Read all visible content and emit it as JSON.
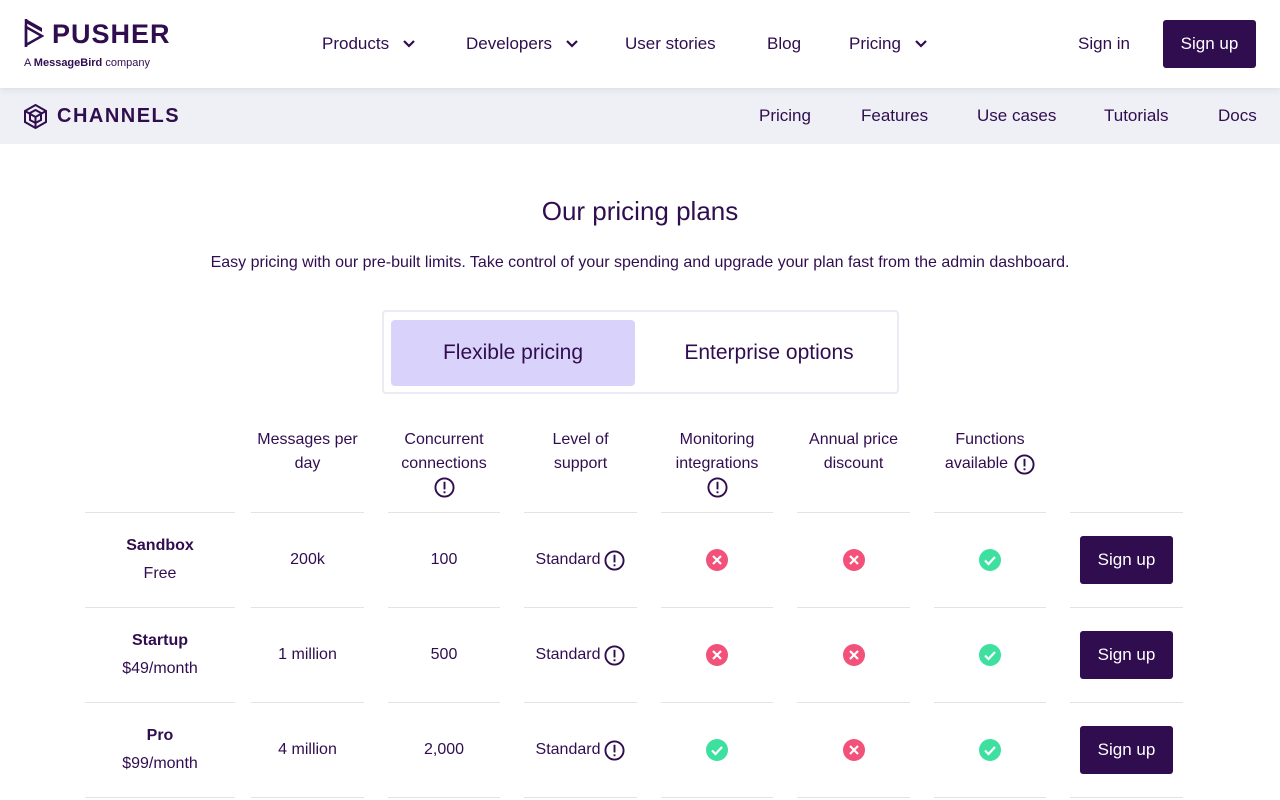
{
  "brand": {
    "name": "PUSHER",
    "sub_prefix": "A",
    "sub_brand": "MessageBird",
    "sub_suffix": "company"
  },
  "topnav": {
    "items": [
      {
        "label": "Products",
        "has_dropdown": true
      },
      {
        "label": "Developers",
        "has_dropdown": true
      },
      {
        "label": "User stories",
        "has_dropdown": false
      },
      {
        "label": "Blog",
        "has_dropdown": false
      },
      {
        "label": "Pricing",
        "has_dropdown": true
      }
    ],
    "sign_in": "Sign in",
    "sign_up": "Sign up"
  },
  "subnav": {
    "product": "CHANNELS",
    "items": [
      "Pricing",
      "Features",
      "Use cases",
      "Tutorials",
      "Docs"
    ]
  },
  "main": {
    "title": "Our pricing plans",
    "subtitle": "Easy pricing with our pre-built limits. Take control of your spending and upgrade your plan fast from the admin dashboard.",
    "tabs": [
      {
        "label": "Flexible pricing",
        "active": true
      },
      {
        "label": "Enterprise options",
        "active": false
      }
    ]
  },
  "table": {
    "columns": [
      {
        "lines": [
          "Messages per",
          "day"
        ],
        "info": false
      },
      {
        "lines": [
          "Concurrent",
          "connections"
        ],
        "info": true
      },
      {
        "lines": [
          "Level of",
          "support"
        ],
        "info": false
      },
      {
        "lines": [
          "Monitoring",
          "integrations"
        ],
        "info": true
      },
      {
        "lines": [
          "Annual price",
          "discount"
        ],
        "info": false
      },
      {
        "lines": [
          "Functions"
        ],
        "last_line": "available",
        "info": true
      }
    ],
    "rows": [
      {
        "plan": "Sandbox",
        "price": "Free",
        "messages": "200k",
        "connections": "100",
        "support": "Standard",
        "monitoring": "no",
        "discount": "no",
        "functions": "yes",
        "cta": "Sign up"
      },
      {
        "plan": "Startup",
        "price": "$49/month",
        "messages": "1 million",
        "connections": "500",
        "support": "Standard",
        "monitoring": "no",
        "discount": "no",
        "functions": "yes",
        "cta": "Sign up"
      },
      {
        "plan": "Pro",
        "price": "$99/month",
        "messages": "4 million",
        "connections": "2,000",
        "support": "Standard",
        "monitoring": "yes",
        "discount": "no",
        "functions": "yes",
        "cta": "Sign up"
      }
    ]
  },
  "colors": {
    "brand_dark": "#300d4f",
    "active_tab": "#d9d2fa",
    "no": "#f2527a",
    "yes": "#3ee0a0",
    "subnav_bg": "#eef0f5"
  }
}
